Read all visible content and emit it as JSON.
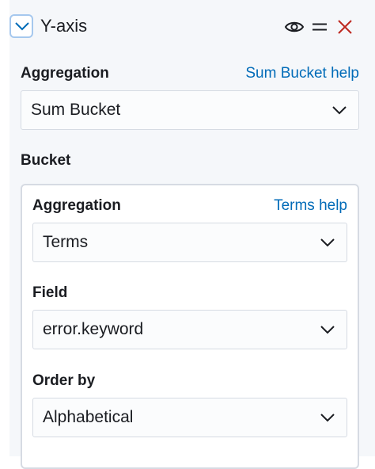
{
  "header": {
    "title": "Y-axis"
  },
  "top": {
    "aggregation_label": "Aggregation",
    "help_link": "Sum Bucket help",
    "aggregation_value": "Sum Bucket"
  },
  "bucket": {
    "label": "Bucket",
    "aggregation_label": "Aggregation",
    "help_link": "Terms help",
    "aggregation_value": "Terms",
    "field_label": "Field",
    "field_value": "error.keyword",
    "order_label": "Order by",
    "order_value": "Alphabetical"
  },
  "colors": {
    "accent": "#006bb8",
    "close": "#bd271e",
    "panel": "#f5f7fa"
  },
  "icons": [
    "chevron-down-icon",
    "eye-icon",
    "drag-handle-icon",
    "close-icon"
  ]
}
